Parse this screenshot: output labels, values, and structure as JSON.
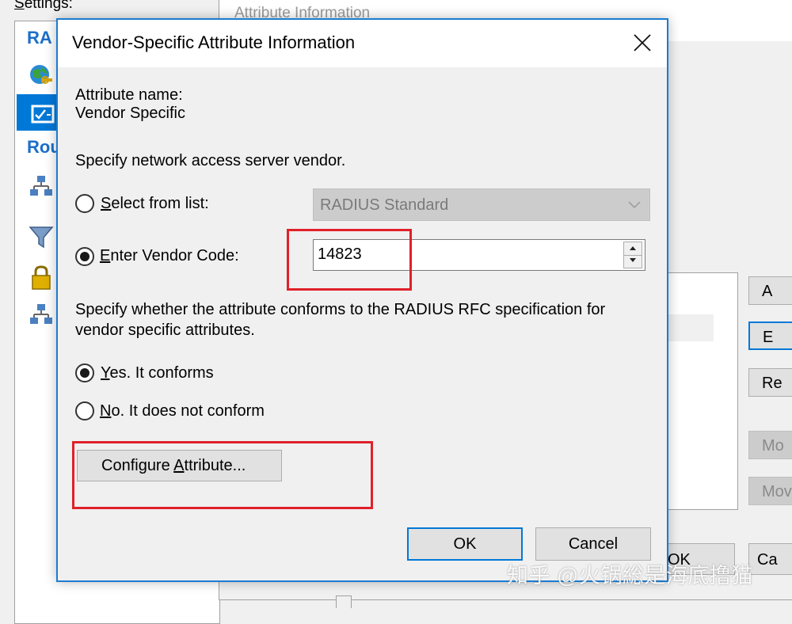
{
  "background": {
    "settings_label": "Settings:",
    "settings_label_accel": "S",
    "settings_label_rest": "ettings:",
    "tree_headers": [
      "RA",
      "Rou"
    ],
    "tree_icons": [
      "globe-key-icon",
      "checklist-icon",
      "network-icon",
      "filter-icon",
      "lock-icon",
      "network-icon"
    ],
    "attribute_info_label": "Attribute Information",
    "side_buttons": [
      "A",
      "E",
      "Re",
      "Mo",
      "Mov"
    ],
    "ok_label": "OK",
    "cancel_label": "Ca"
  },
  "dialog": {
    "title": "Vendor-Specific Attribute Information",
    "attribute_name_label": "Attribute name:",
    "attribute_name_value": "Vendor Specific",
    "specify_vendor_text": "Specify network access server vendor.",
    "select_from_list": {
      "accel": "S",
      "rest": "elect from list:",
      "checked": false,
      "selected_value": "RADIUS Standard",
      "enabled": false
    },
    "enter_vendor_code": {
      "accel": "E",
      "rest": "nter Vendor Code:",
      "checked": true,
      "value": "14823"
    },
    "conform_text_line1": "Specify whether the attribute conforms to the RADIUS RFC specification for",
    "conform_text_line2": "vendor specific attributes.",
    "yes_conforms": {
      "accel": "Y",
      "rest": "es. It conforms",
      "checked": true
    },
    "no_conform": {
      "accel": "N",
      "rest": "o. It does not conform",
      "checked": false
    },
    "configure_button": {
      "pre": "Configure ",
      "accel": "A",
      "post": "ttribute..."
    },
    "ok_label": "OK",
    "cancel_label": "Cancel"
  },
  "highlight_color": "#e0202a",
  "accent_color": "#0078d7",
  "watermark": "知乎 @火锅総是海底撸猫"
}
